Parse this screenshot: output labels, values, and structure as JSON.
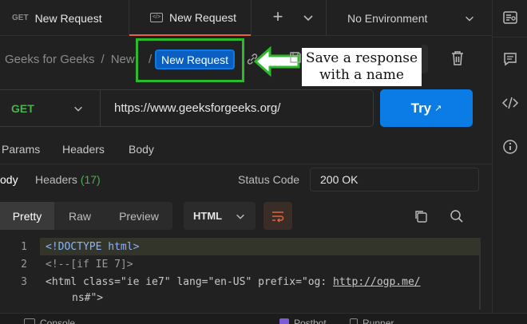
{
  "tabs": [
    {
      "method": "GET",
      "title": "New Request"
    },
    {
      "title": "New Request"
    }
  ],
  "environment": {
    "selected": "No Environment"
  },
  "breadcrumb": {
    "workspace": "Geeks for Geeks",
    "sep": "/",
    "folder": "New",
    "current": "New Request"
  },
  "annotation": {
    "text_line1": "Save a response",
    "text_line2": "with a name",
    "highlight_color": "#2eb82e"
  },
  "request": {
    "method": "GET",
    "url": "https://www.geeksforgeeks.org/",
    "send_label": "Try",
    "send_icon": "↗"
  },
  "request_tabs": [
    "Params",
    "Headers",
    "Body"
  ],
  "response": {
    "tab_body": "ody",
    "tab_headers": "Headers",
    "headers_count": "(17)",
    "status_label": "Status Code",
    "status_value": "200 OK",
    "view_modes": [
      "Pretty",
      "Raw",
      "Preview"
    ],
    "format": "HTML"
  },
  "code_lines": [
    {
      "n": "1",
      "text": "<!DOCTYPE html>"
    },
    {
      "n": "2",
      "text": "<!--[if IE 7]>"
    },
    {
      "n": "3",
      "text_a": "<html class=\"ie ie7\" lang=\"en-US\" prefix=\"og: ",
      "link": "http://ogp.me/",
      "wrap": "ns#\">"
    }
  ],
  "footer": {
    "console": "Console",
    "postbot": "Postbot",
    "runner": "Runner"
  },
  "colors": {
    "accent": "#0b7ce6",
    "get_method": "#4caf50",
    "status_ok": "#e6e6e6",
    "tab_active_line": "#e8613c",
    "highlight": "#2eb82e"
  }
}
